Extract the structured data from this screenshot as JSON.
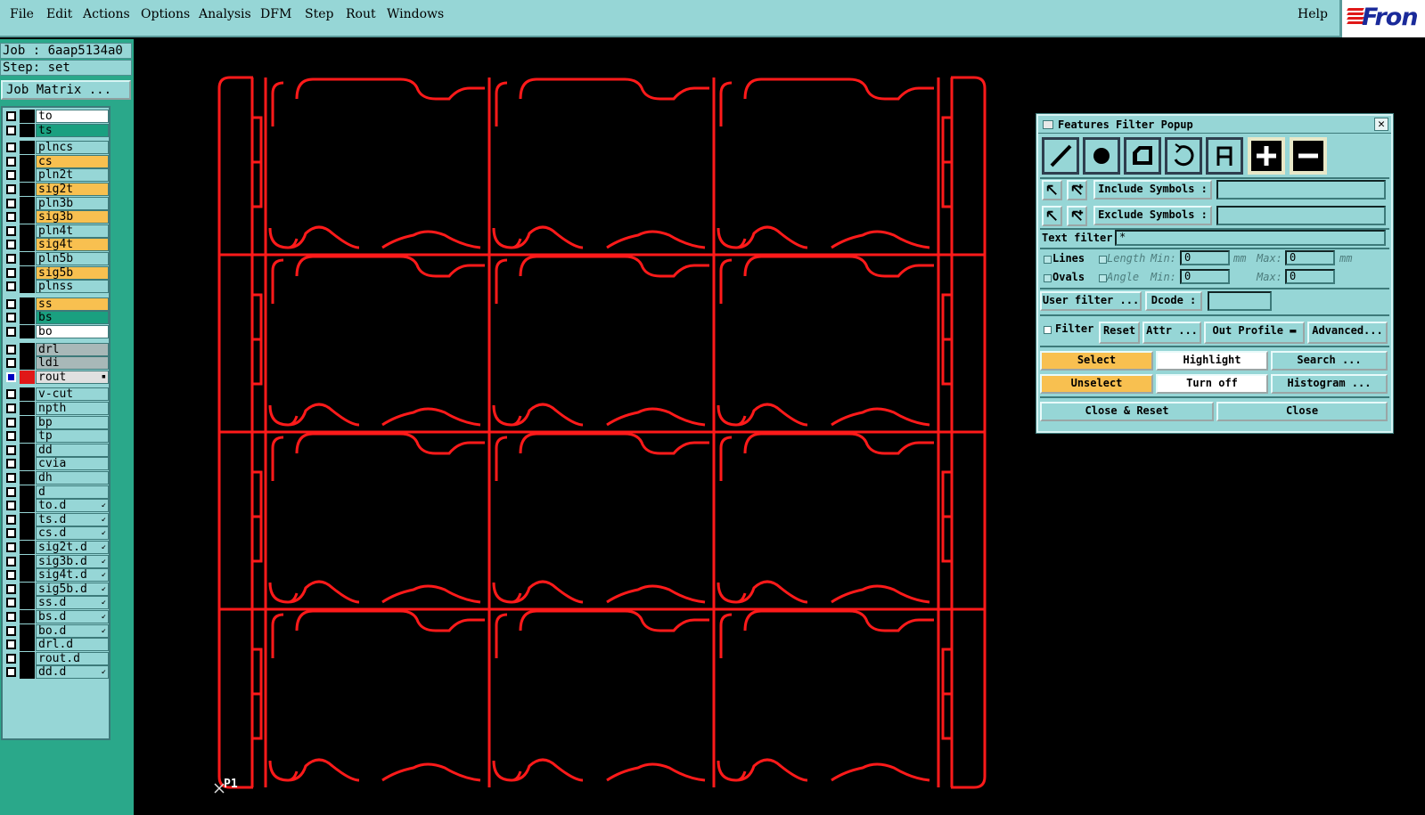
{
  "menu": {
    "items": [
      "File",
      "Edit",
      "Actions",
      "Options",
      "Analysis",
      "DFM",
      "Step",
      "Rout",
      "Windows"
    ],
    "help": "Help",
    "logo": "Fron"
  },
  "left": {
    "job_line": "Job : 6aap5134a0",
    "step_line": "Step: set",
    "job_matrix": "Job Matrix ..."
  },
  "layers": [
    {
      "name": "to",
      "color": "#ffffff",
      "group": 0
    },
    {
      "name": "ts",
      "color": "#1aa080",
      "group": 0
    },
    {
      "name": "plncs",
      "color": "#96d6d6",
      "group": 1
    },
    {
      "name": "cs",
      "color": "#f8c050",
      "group": 1
    },
    {
      "name": "pln2t",
      "color": "#96d6d6",
      "group": 1
    },
    {
      "name": "sig2t",
      "color": "#f8c050",
      "group": 1
    },
    {
      "name": "pln3b",
      "color": "#96d6d6",
      "group": 1
    },
    {
      "name": "sig3b",
      "color": "#f8c050",
      "group": 1
    },
    {
      "name": "pln4t",
      "color": "#96d6d6",
      "group": 1
    },
    {
      "name": "sig4t",
      "color": "#f8c050",
      "group": 1
    },
    {
      "name": "pln5b",
      "color": "#96d6d6",
      "group": 1
    },
    {
      "name": "sig5b",
      "color": "#f8c050",
      "group": 1
    },
    {
      "name": "plnss",
      "color": "#96d6d6",
      "group": 1
    },
    {
      "name": "ss",
      "color": "#f8c050",
      "group": 2
    },
    {
      "name": "bs",
      "color": "#1aa080",
      "group": 2
    },
    {
      "name": "bo",
      "color": "#ffffff",
      "group": 2
    },
    {
      "name": "drl",
      "color": "#a8b8b8",
      "group": 3
    },
    {
      "name": "ldi",
      "color": "#a8b8b8",
      "group": 3
    },
    {
      "name": "rout",
      "color": "#e0e0e0",
      "group": 3,
      "active": true
    },
    {
      "name": "v-cut",
      "color": "#96d6d6",
      "group": 4
    },
    {
      "name": "npth",
      "color": "#96d6d6",
      "group": 4
    },
    {
      "name": "bp",
      "color": "#96d6d6",
      "group": 4
    },
    {
      "name": "tp",
      "color": "#96d6d6",
      "group": 4
    },
    {
      "name": "dd",
      "color": "#96d6d6",
      "group": 4
    },
    {
      "name": "cvia",
      "color": "#96d6d6",
      "group": 4
    },
    {
      "name": "dh",
      "color": "#96d6d6",
      "group": 4
    },
    {
      "name": "d",
      "color": "#96d6d6",
      "group": 4
    },
    {
      "name": "to.d",
      "color": "#96d6d6",
      "group": 4,
      "arrow": true
    },
    {
      "name": "ts.d",
      "color": "#96d6d6",
      "group": 4,
      "arrow": true
    },
    {
      "name": "cs.d",
      "color": "#96d6d6",
      "group": 4,
      "arrow": true
    },
    {
      "name": "sig2t.d",
      "color": "#96d6d6",
      "group": 4,
      "arrow": true
    },
    {
      "name": "sig3b.d",
      "color": "#96d6d6",
      "group": 4,
      "arrow": true
    },
    {
      "name": "sig4t.d",
      "color": "#96d6d6",
      "group": 4,
      "arrow": true
    },
    {
      "name": "sig5b.d",
      "color": "#96d6d6",
      "group": 4,
      "arrow": true
    },
    {
      "name": "ss.d",
      "color": "#96d6d6",
      "group": 4,
      "arrow": true
    },
    {
      "name": "bs.d",
      "color": "#96d6d6",
      "group": 4,
      "arrow": true
    },
    {
      "name": "bo.d",
      "color": "#96d6d6",
      "group": 4,
      "arrow": true
    },
    {
      "name": "drl.d",
      "color": "#96d6d6",
      "group": 4
    },
    {
      "name": "rout.d",
      "color": "#96d6d6",
      "group": 4
    },
    {
      "name": "dd.d",
      "color": "#96d6d6",
      "group": 4,
      "arrow": true
    }
  ],
  "canvas": {
    "origin_label": "P1",
    "stroke_color": "#ff1a1a"
  },
  "popup": {
    "title": "Features Filter Popup",
    "close_glyph": "✕",
    "tools": [
      "line-tool-icon",
      "pad-tool-icon",
      "surface-tool-icon",
      "arc-tool-icon",
      "text-tool-icon",
      "plus-icon",
      "minus-icon"
    ],
    "include_symbols": "Include Symbols :",
    "include_value": "",
    "exclude_symbols": "Exclude Symbols :",
    "exclude_value": "",
    "text_filter_label": "Text filter",
    "text_filter_value": "*",
    "lines": "Lines",
    "ovals": "Ovals",
    "length": "Length",
    "angle": "Angle",
    "min": "Min:",
    "max": "Max:",
    "unit": "mm",
    "length_min": "0",
    "length_max": "0",
    "angle_min": "0",
    "angle_max": "0",
    "user_filter": "User filter ...",
    "dcode": "Dcode :",
    "dcode_value": "",
    "filter": "Filter",
    "reset": "Reset",
    "attr": "Attr ...",
    "out_profile": "Out Profile",
    "advanced": "Advanced...",
    "select": "Select",
    "highlight": "Highlight",
    "search": "Search ...",
    "unselect": "Unselect",
    "turn_off": "Turn off",
    "histogram": "Histogram ...",
    "close_reset": "Close & Reset",
    "close": "Close"
  }
}
